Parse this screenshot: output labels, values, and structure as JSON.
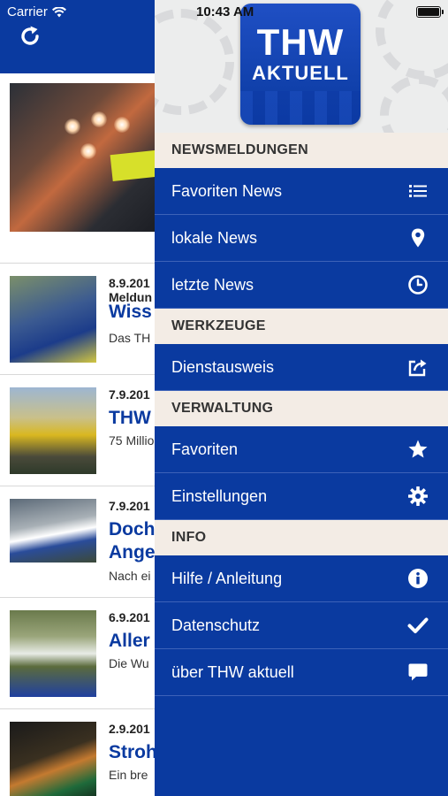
{
  "status_bar": {
    "carrier": "Carrier",
    "time": "10:43 AM"
  },
  "news": [
    {
      "date": "8.9.201",
      "meta": "Meldun",
      "title": "Wiss",
      "teaser": "Das TH"
    },
    {
      "date": "7.9.201",
      "meta": "",
      "title": "THW",
      "teaser": "75 Millio"
    },
    {
      "date": "7.9.201",
      "meta": "",
      "title": "Doch",
      "title2": "Ange",
      "teaser": "Nach ei"
    },
    {
      "date": "6.9.201",
      "meta": "",
      "title": "Aller",
      "teaser": "Die Wu"
    },
    {
      "date": "2.9.201",
      "meta": "",
      "title": "Stroh",
      "teaser": "Ein bre"
    }
  ],
  "drawer": {
    "logo": {
      "line1": "THW",
      "line2": "AKTUELL"
    },
    "sections": [
      {
        "title": "NEWSMELDUNGEN",
        "items": [
          {
            "label": "Favoriten News",
            "icon": "list-icon"
          },
          {
            "label": "lokale News",
            "icon": "location-pin-icon"
          },
          {
            "label": "letzte News",
            "icon": "clock-icon"
          }
        ]
      },
      {
        "title": "WERKZEUGE",
        "items": [
          {
            "label": "Dienstausweis",
            "icon": "share-icon"
          }
        ]
      },
      {
        "title": "VERWALTUNG",
        "items": [
          {
            "label": "Favoriten",
            "icon": "star-icon"
          },
          {
            "label": "Einstellungen",
            "icon": "gear-icon"
          }
        ]
      },
      {
        "title": "INFO",
        "items": [
          {
            "label": "Hilfe / Anleitung",
            "icon": "info-icon"
          },
          {
            "label": "Datenschutz",
            "icon": "checkmark-icon"
          },
          {
            "label": "über THW aktuell",
            "icon": "speech-bubble-icon"
          }
        ]
      }
    ]
  },
  "colors": {
    "brand_blue": "#0a3aa0",
    "section_bg": "#f3ece5"
  }
}
